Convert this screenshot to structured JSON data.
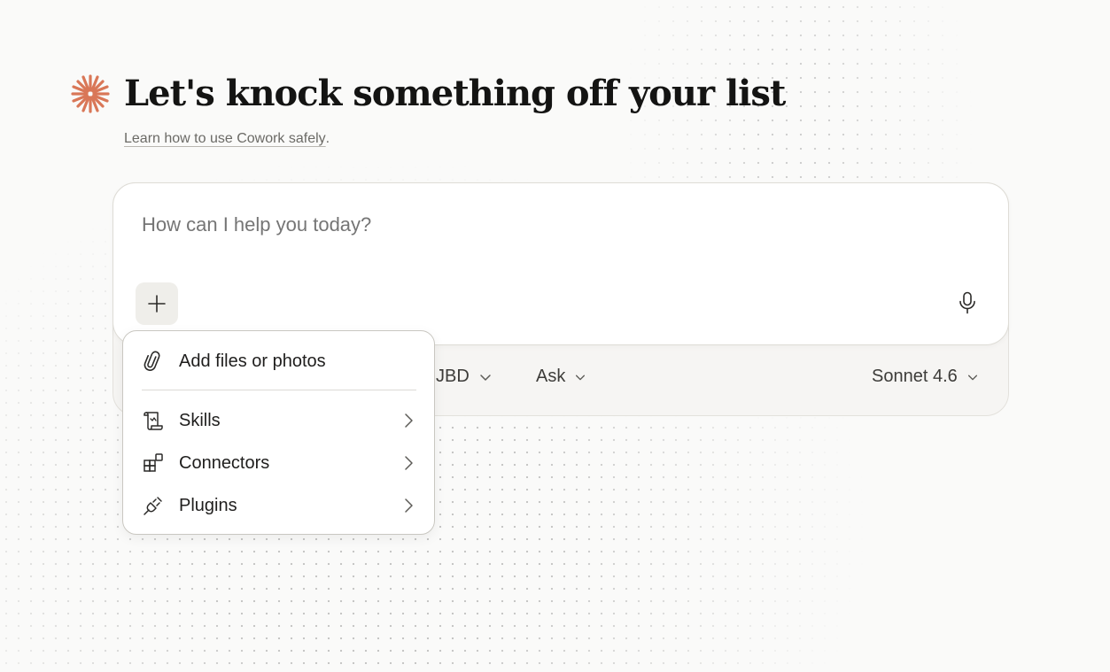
{
  "hero": {
    "title": "Let's knock something off your list",
    "safety_link": "Learn how to use Cowork safely",
    "safety_period": "."
  },
  "composer": {
    "placeholder": "How can I help you today?"
  },
  "toolbar": {
    "folder_label": "JBD",
    "mode_label": "Ask",
    "model_label": "Sonnet 4.6"
  },
  "menu": {
    "add_files": "Add files or photos",
    "items": [
      {
        "label": "Skills",
        "icon": "scroll-icon"
      },
      {
        "label": "Connectors",
        "icon": "connectors-icon"
      },
      {
        "label": "Plugins",
        "icon": "plug-icon"
      }
    ]
  },
  "colors": {
    "accent": "#d97757",
    "background": "#fafaf9"
  }
}
